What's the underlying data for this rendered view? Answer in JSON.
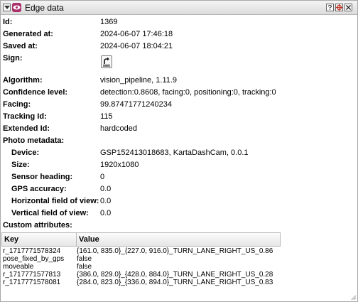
{
  "window": {
    "title": "Edge data"
  },
  "fields": [
    {
      "label": "Id:",
      "value": "1369"
    },
    {
      "label": "Generated at:",
      "value": "2024-06-07 17:46:18"
    },
    {
      "label": "Saved at:",
      "value": "2024-06-07 18:04:21"
    },
    {
      "label": "Sign:",
      "value": ""
    },
    {
      "label": "Algorithm:",
      "value": "vision_pipeline, 1.11.9"
    },
    {
      "label": "Confidence level:",
      "value": "detection:0.8608, facing:0, positioning:0, tracking:0"
    },
    {
      "label": "Facing:",
      "value": "99.87471771240234"
    },
    {
      "label": "Tracking Id:",
      "value": "115"
    },
    {
      "label": "Extended Id:",
      "value": "hardcoded"
    },
    {
      "label": "Photo metadata:",
      "value": ""
    }
  ],
  "photo_metadata": [
    {
      "label": "Device:",
      "value": "GSP152413018683, KartaDashCam, 0.0.1"
    },
    {
      "label": "Size:",
      "value": "1920x1080"
    },
    {
      "label": "Sensor heading:",
      "value": "0"
    },
    {
      "label": "GPS accuracy:",
      "value": "0.0"
    },
    {
      "label": "Horizontal field of view:",
      "value": "0.0"
    },
    {
      "label": "Vertical field of view:",
      "value": "0.0"
    }
  ],
  "custom_attributes": {
    "label": "Custom attributes:",
    "headers": {
      "key": "Key",
      "value": "Value"
    },
    "rows": [
      {
        "key": "r_1717771578324",
        "value": "{161.0, 835.0}_{227.0, 916.0}_TURN_LANE_RIGHT_US_0.86"
      },
      {
        "key": "pose_fixed_by_gps",
        "value": "false"
      },
      {
        "key": "moveable",
        "value": "false"
      },
      {
        "key": "r_1717771577813",
        "value": "{386.0, 829.0}_{428.0, 884.0}_TURN_LANE_RIGHT_US_0.28"
      },
      {
        "key": "r_1717771578081",
        "value": "{284.0, 823.0}_{336.0, 894.0}_TURN_LANE_RIGHT_US_0.83"
      }
    ]
  },
  "icons": {
    "collapse": "collapse-triangle-icon",
    "eye": "eye-icon",
    "sign": "turn-right-only-sign-icon",
    "title_buttons": [
      "help-icon",
      "detach-icon",
      "close-icon"
    ]
  },
  "colors": {
    "eye_badge": "#a8306b",
    "close_button": "#d9534f"
  }
}
